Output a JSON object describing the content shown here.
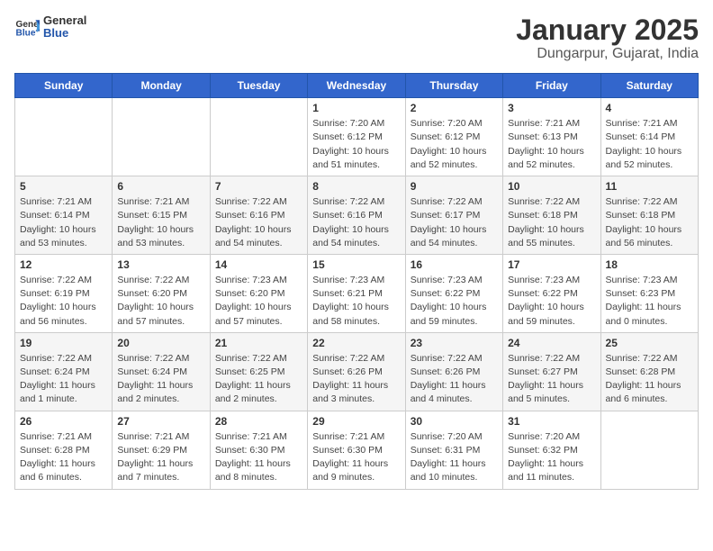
{
  "header": {
    "logo_general": "General",
    "logo_blue": "Blue",
    "title": "January 2025",
    "subtitle": "Dungarpur, Gujarat, India"
  },
  "days_of_week": [
    "Sunday",
    "Monday",
    "Tuesday",
    "Wednesday",
    "Thursday",
    "Friday",
    "Saturday"
  ],
  "weeks": [
    [
      {
        "num": "",
        "info": ""
      },
      {
        "num": "",
        "info": ""
      },
      {
        "num": "",
        "info": ""
      },
      {
        "num": "1",
        "info": "Sunrise: 7:20 AM\nSunset: 6:12 PM\nDaylight: 10 hours\nand 51 minutes."
      },
      {
        "num": "2",
        "info": "Sunrise: 7:20 AM\nSunset: 6:12 PM\nDaylight: 10 hours\nand 52 minutes."
      },
      {
        "num": "3",
        "info": "Sunrise: 7:21 AM\nSunset: 6:13 PM\nDaylight: 10 hours\nand 52 minutes."
      },
      {
        "num": "4",
        "info": "Sunrise: 7:21 AM\nSunset: 6:14 PM\nDaylight: 10 hours\nand 52 minutes."
      }
    ],
    [
      {
        "num": "5",
        "info": "Sunrise: 7:21 AM\nSunset: 6:14 PM\nDaylight: 10 hours\nand 53 minutes."
      },
      {
        "num": "6",
        "info": "Sunrise: 7:21 AM\nSunset: 6:15 PM\nDaylight: 10 hours\nand 53 minutes."
      },
      {
        "num": "7",
        "info": "Sunrise: 7:22 AM\nSunset: 6:16 PM\nDaylight: 10 hours\nand 54 minutes."
      },
      {
        "num": "8",
        "info": "Sunrise: 7:22 AM\nSunset: 6:16 PM\nDaylight: 10 hours\nand 54 minutes."
      },
      {
        "num": "9",
        "info": "Sunrise: 7:22 AM\nSunset: 6:17 PM\nDaylight: 10 hours\nand 54 minutes."
      },
      {
        "num": "10",
        "info": "Sunrise: 7:22 AM\nSunset: 6:18 PM\nDaylight: 10 hours\nand 55 minutes."
      },
      {
        "num": "11",
        "info": "Sunrise: 7:22 AM\nSunset: 6:18 PM\nDaylight: 10 hours\nand 56 minutes."
      }
    ],
    [
      {
        "num": "12",
        "info": "Sunrise: 7:22 AM\nSunset: 6:19 PM\nDaylight: 10 hours\nand 56 minutes."
      },
      {
        "num": "13",
        "info": "Sunrise: 7:22 AM\nSunset: 6:20 PM\nDaylight: 10 hours\nand 57 minutes."
      },
      {
        "num": "14",
        "info": "Sunrise: 7:23 AM\nSunset: 6:20 PM\nDaylight: 10 hours\nand 57 minutes."
      },
      {
        "num": "15",
        "info": "Sunrise: 7:23 AM\nSunset: 6:21 PM\nDaylight: 10 hours\nand 58 minutes."
      },
      {
        "num": "16",
        "info": "Sunrise: 7:23 AM\nSunset: 6:22 PM\nDaylight: 10 hours\nand 59 minutes."
      },
      {
        "num": "17",
        "info": "Sunrise: 7:23 AM\nSunset: 6:22 PM\nDaylight: 10 hours\nand 59 minutes."
      },
      {
        "num": "18",
        "info": "Sunrise: 7:23 AM\nSunset: 6:23 PM\nDaylight: 11 hours\nand 0 minutes."
      }
    ],
    [
      {
        "num": "19",
        "info": "Sunrise: 7:22 AM\nSunset: 6:24 PM\nDaylight: 11 hours\nand 1 minute."
      },
      {
        "num": "20",
        "info": "Sunrise: 7:22 AM\nSunset: 6:24 PM\nDaylight: 11 hours\nand 2 minutes."
      },
      {
        "num": "21",
        "info": "Sunrise: 7:22 AM\nSunset: 6:25 PM\nDaylight: 11 hours\nand 2 minutes."
      },
      {
        "num": "22",
        "info": "Sunrise: 7:22 AM\nSunset: 6:26 PM\nDaylight: 11 hours\nand 3 minutes."
      },
      {
        "num": "23",
        "info": "Sunrise: 7:22 AM\nSunset: 6:26 PM\nDaylight: 11 hours\nand 4 minutes."
      },
      {
        "num": "24",
        "info": "Sunrise: 7:22 AM\nSunset: 6:27 PM\nDaylight: 11 hours\nand 5 minutes."
      },
      {
        "num": "25",
        "info": "Sunrise: 7:22 AM\nSunset: 6:28 PM\nDaylight: 11 hours\nand 6 minutes."
      }
    ],
    [
      {
        "num": "26",
        "info": "Sunrise: 7:21 AM\nSunset: 6:28 PM\nDaylight: 11 hours\nand 6 minutes."
      },
      {
        "num": "27",
        "info": "Sunrise: 7:21 AM\nSunset: 6:29 PM\nDaylight: 11 hours\nand 7 minutes."
      },
      {
        "num": "28",
        "info": "Sunrise: 7:21 AM\nSunset: 6:30 PM\nDaylight: 11 hours\nand 8 minutes."
      },
      {
        "num": "29",
        "info": "Sunrise: 7:21 AM\nSunset: 6:30 PM\nDaylight: 11 hours\nand 9 minutes."
      },
      {
        "num": "30",
        "info": "Sunrise: 7:20 AM\nSunset: 6:31 PM\nDaylight: 11 hours\nand 10 minutes."
      },
      {
        "num": "31",
        "info": "Sunrise: 7:20 AM\nSunset: 6:32 PM\nDaylight: 11 hours\nand 11 minutes."
      },
      {
        "num": "",
        "info": ""
      }
    ]
  ]
}
